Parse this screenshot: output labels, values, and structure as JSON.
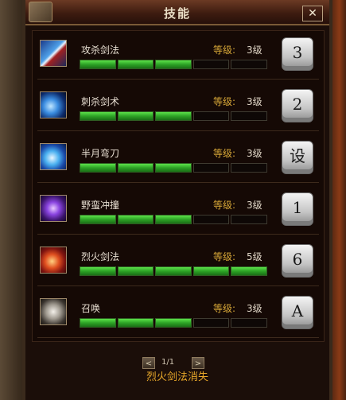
{
  "window": {
    "title": "技能",
    "close_label": "✕"
  },
  "skills": [
    {
      "name": "攻杀剑法",
      "level_label": "等级:",
      "level_value": "3级",
      "progress_filled": 3,
      "progress_total": 5,
      "hotkey": "3",
      "icon": "sword-thrust-icon"
    },
    {
      "name": "刺杀剑术",
      "level_label": "等级:",
      "level_value": "3级",
      "progress_filled": 3,
      "progress_total": 5,
      "hotkey": "2",
      "icon": "blue-slash-icon"
    },
    {
      "name": "半月弯刀",
      "level_label": "等级:",
      "level_value": "3级",
      "progress_filled": 3,
      "progress_total": 5,
      "hotkey": "设",
      "icon": "crescent-blade-icon"
    },
    {
      "name": "野蛮冲撞",
      "level_label": "等级:",
      "level_value": "3级",
      "progress_filled": 3,
      "progress_total": 5,
      "hotkey": "1",
      "icon": "purple-figure-icon"
    },
    {
      "name": "烈火剑法",
      "level_label": "等级:",
      "level_value": "5级",
      "progress_filled": 5,
      "progress_total": 5,
      "hotkey": "6",
      "icon": "fire-sword-icon"
    },
    {
      "name": "召唤",
      "level_label": "等级:",
      "level_value": "3级",
      "progress_filled": 3,
      "progress_total": 5,
      "hotkey": "A",
      "icon": "summon-skull-icon"
    }
  ],
  "pager": {
    "prev": "<",
    "text": "1/1",
    "next": ">"
  },
  "status_message": "烈火剑法消失"
}
